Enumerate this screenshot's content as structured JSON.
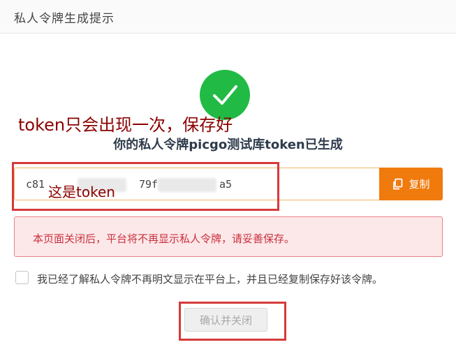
{
  "dialog": {
    "title": "私人令牌生成提示"
  },
  "annotations": {
    "top_note": "token只会出现一次，保存好",
    "token_note": "这是token"
  },
  "result": {
    "title": "你的私人令牌picgo测试库token已生成"
  },
  "token": {
    "part1": "c81",
    "part2": "79f",
    "part3": "a5"
  },
  "copy_button": {
    "label": "复制"
  },
  "alert": {
    "message": "本页面关闭后，平台将不再显示私人令牌，请妥善保存。"
  },
  "agreement": {
    "label": "我已经了解私人令牌不再明文显示在平台上，并且已经复制保存好该令牌。",
    "checked": false
  },
  "confirm_button": {
    "label": "确认并关闭"
  },
  "colors": {
    "success": "#21ba45",
    "accent": "#f07a0c",
    "alert_text": "#c9303e",
    "annotation": "#d63a3a"
  }
}
